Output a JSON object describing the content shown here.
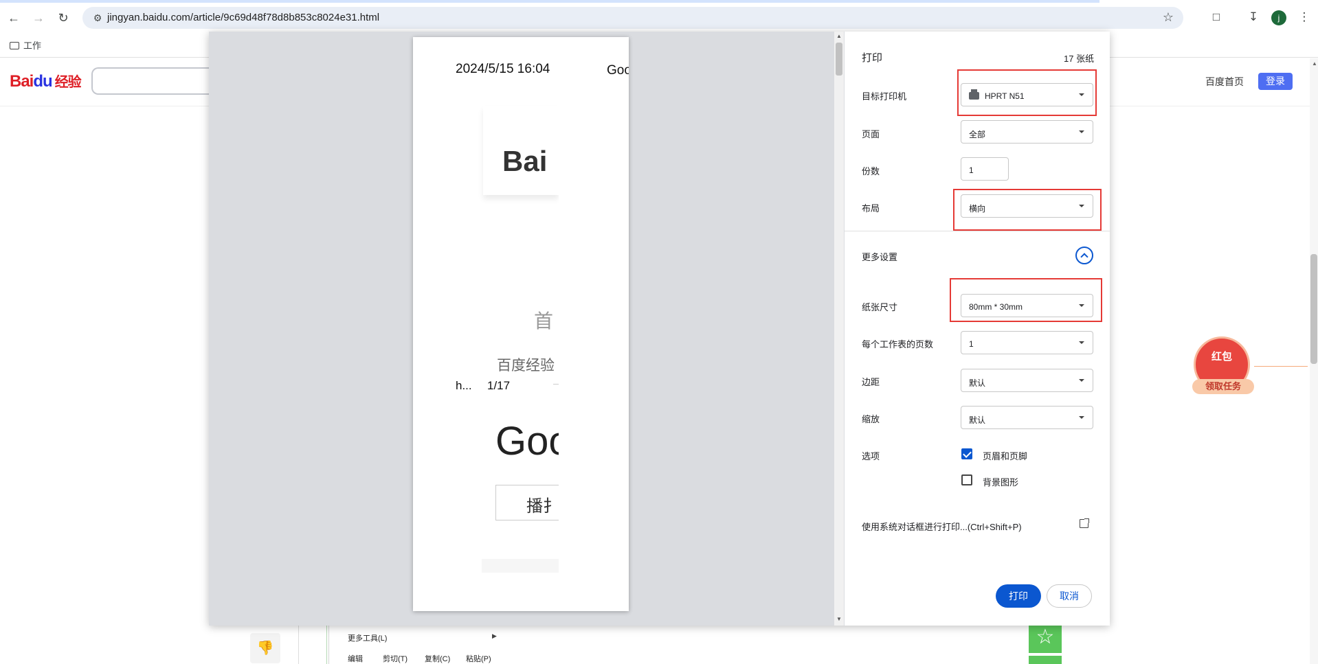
{
  "browser": {
    "url": "jingyan.baidu.com/article/9c69d48f78d8b853c8024e31.html",
    "avatar_letter": "j",
    "bookmark": "工作"
  },
  "baidu": {
    "logo_bai": "Bai",
    "logo_du": "du",
    "logo_jy": "经验",
    "home_link": "百度首页",
    "login": "登录",
    "redpacket_title": "红包",
    "redpacket_btn": "领取任务",
    "menu_more_tools": "更多工具(L)",
    "menu_edit": "编辑",
    "menu_cut": "剪切(T)",
    "menu_copy": "复制(C)",
    "menu_paste": "粘贴(P)"
  },
  "preview": {
    "date": "2024/5/15 16:04",
    "goc_top": "Goo",
    "bai": "Bai",
    "shou": "首",
    "baidujy": "百度经验",
    "h": "h...",
    "page": "1/17",
    "goc_big": "Goo",
    "play": "播扌"
  },
  "settings": {
    "title": "打印",
    "sheet_count": "17 张纸",
    "printer_label": "目标打印机",
    "printer_value": "HPRT N51",
    "pages_label": "页面",
    "pages_value": "全部",
    "copies_label": "份数",
    "copies_value": "1",
    "layout_label": "布局",
    "layout_value": "横向",
    "more_label": "更多设置",
    "paper_label": "纸张尺寸",
    "paper_value": "80mm * 30mm",
    "pps_label": "每个工作表的页数",
    "pps_value": "1",
    "margin_label": "边距",
    "margin_value": "默认",
    "scale_label": "缩放",
    "scale_value": "默认",
    "options_label": "选项",
    "opt_headers": "页眉和页脚",
    "opt_bg": "背景图形",
    "system_dialog": "使用系统对话框进行打印...(Ctrl+Shift+P)",
    "print_btn": "打印",
    "cancel_btn": "取消"
  },
  "colors": {
    "accent": "#0b57d0",
    "highlight": "#e53935",
    "baidu_blue": "#4e6ef2"
  }
}
